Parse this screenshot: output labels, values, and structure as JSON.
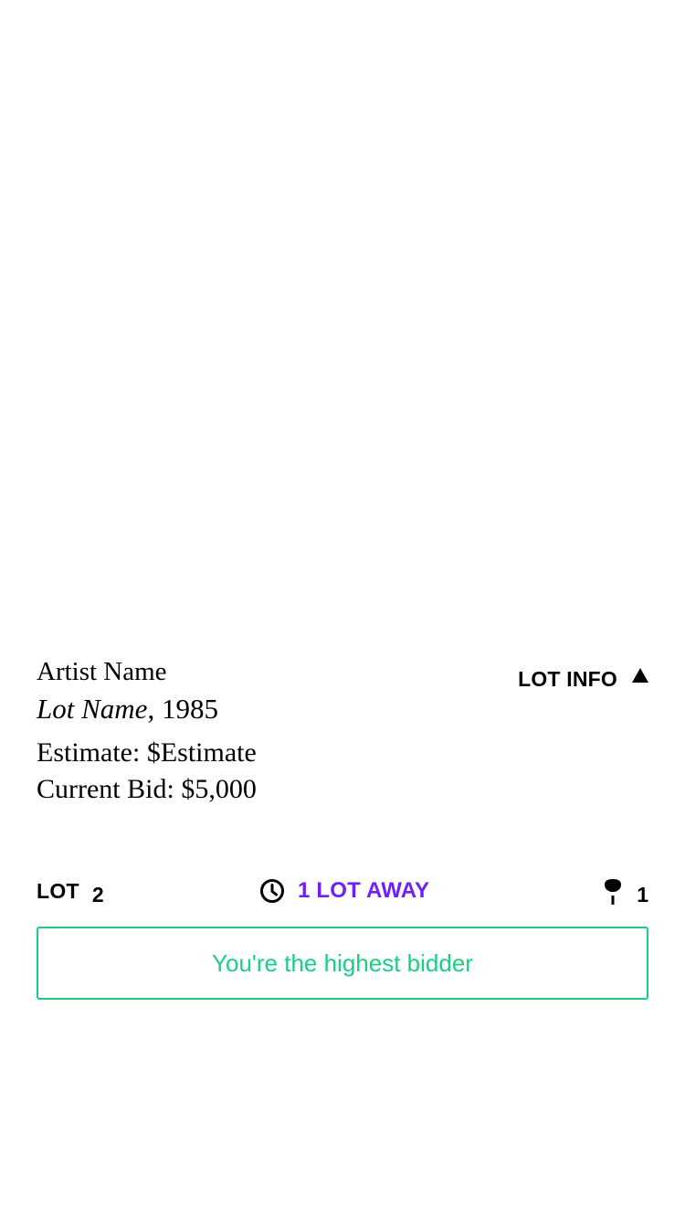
{
  "lot": {
    "artist_name": "Artist Name",
    "lot_name": "Lot Name",
    "year": "1985",
    "estimate_label": "Estimate:",
    "estimate_value": "$Estimate",
    "current_bid_label": "Current Bid:",
    "current_bid_value": "$5,000"
  },
  "lot_info_toggle": {
    "label": "LOT INFO",
    "icon": "triangle-up-icon"
  },
  "status": {
    "lot_label": "LOT",
    "lot_number": "2",
    "countdown_icon": "clock-icon",
    "countdown_text": "1 LOT AWAY",
    "countdown_color": "#6e1fff",
    "bid_icon": "paddle-icon",
    "bid_count": "1"
  },
  "bid_status": {
    "label": "You're the highest bidder",
    "color": "#19d082"
  }
}
